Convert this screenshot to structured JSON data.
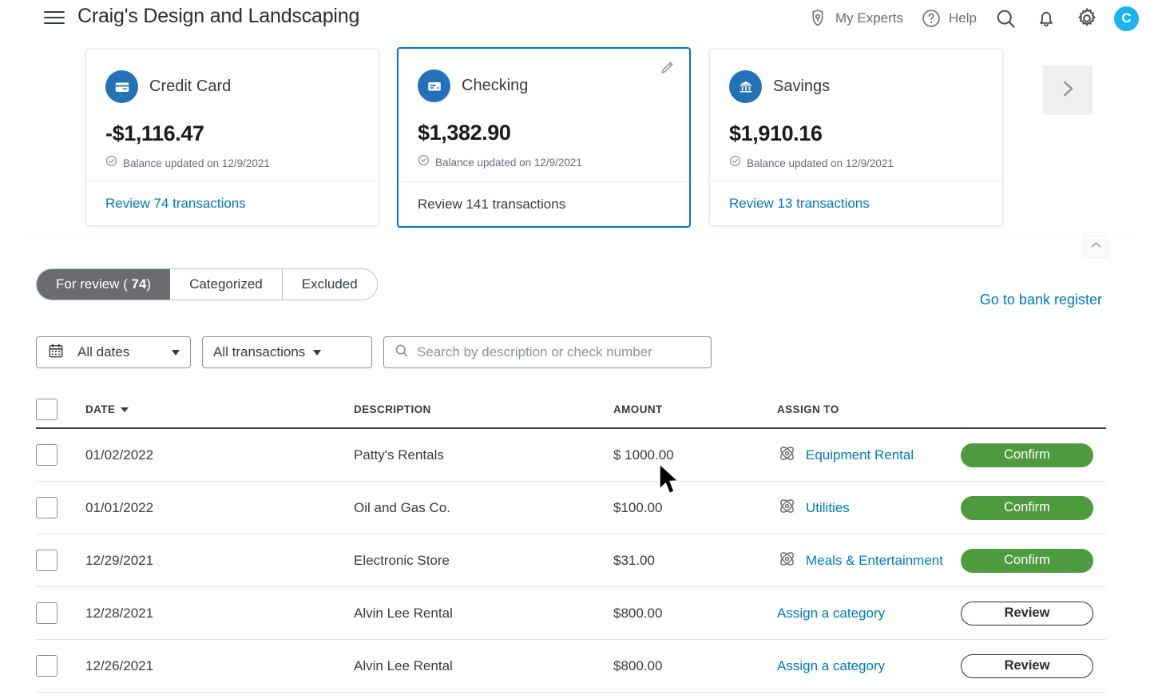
{
  "header": {
    "menu_icon": "hamburger-menu-icon",
    "company_title": "Craig's Design and Landscaping",
    "my_experts_label": "My Experts",
    "my_experts_icon": "person-shield-icon",
    "help_label": "Help",
    "help_icon": "question-circle-icon",
    "search_icon": "search-icon",
    "notifications_icon": "bell-icon",
    "settings_icon": "gear-icon",
    "avatar_initial": "C",
    "avatar_color": "#1ab2f0"
  },
  "accounts": [
    {
      "name": "Credit Card",
      "icon": "credit-card-icon",
      "balance": "-$1,116.47",
      "updated_text": "Balance updated on 12/9/2021",
      "updated_icon": "check-circle-icon",
      "review_link": "Review 74 transactions",
      "selected": false
    },
    {
      "name": "Checking",
      "icon": "checking-account-icon",
      "balance": "$1,382.90",
      "updated_text": "Balance updated on 12/9/2021",
      "updated_icon": "check-circle-icon",
      "review_link": "Review 141 transactions",
      "selected": true,
      "edit_icon": "pencil-edit-icon"
    },
    {
      "name": "Savings",
      "icon": "bank-building-icon",
      "balance": "$1,910.16",
      "updated_text": "Balance updated on 12/9/2021",
      "updated_icon": "check-circle-icon",
      "review_link": "Review 13 transactions",
      "selected": false
    }
  ],
  "carousel": {
    "next_icon": "chevron-right-icon"
  },
  "collapse": {
    "icon": "chevron-up-icon"
  },
  "tabs": [
    {
      "label": "For review",
      "count": "74",
      "active": true
    },
    {
      "label": "Categorized",
      "count": "",
      "active": false
    },
    {
      "label": "Excluded",
      "count": "",
      "active": false
    }
  ],
  "bank_register_link": "Go to bank register",
  "filters": {
    "date_filter_label": "All dates",
    "date_filter_icon": "calendar-icon",
    "type_filter_label": "All transactions",
    "search_placeholder": "Search by description or check number",
    "search_value": "",
    "search_icon": "search-icon"
  },
  "table": {
    "columns": {
      "date": "DATE",
      "description": "DESCRIPTION",
      "amount": "AMOUNT",
      "assign_to": "ASSIGN TO"
    },
    "sort_icon": "sort-descending-caret-icon",
    "rows": [
      {
        "date": "01/02/2022",
        "description": "Patty's Rentals",
        "amount": "$ 1000.00",
        "category": "Equipment Rental",
        "has_rule_icon": true,
        "rule_icon": "category-rule-icon",
        "action": "Confirm",
        "action_type": "confirm"
      },
      {
        "date": "01/01/2022",
        "description": "Oil and Gas Co.",
        "amount": "$100.00",
        "category": "Utilities",
        "has_rule_icon": true,
        "rule_icon": "category-rule-icon",
        "action": "Confirm",
        "action_type": "confirm"
      },
      {
        "date": "12/29/2021",
        "description": "Electronic Store",
        "amount": "$31.00",
        "category": "Meals & Entertainment",
        "has_rule_icon": true,
        "rule_icon": "category-rule-icon",
        "action": "Confirm",
        "action_type": "confirm"
      },
      {
        "date": "12/28/2021",
        "description": "Alvin Lee Rental",
        "amount": "$800.00",
        "category": "Assign a category",
        "has_rule_icon": false,
        "rule_icon": "",
        "action": "Review",
        "action_type": "review"
      },
      {
        "date": "12/26/2021",
        "description": "Alvin Lee Rental",
        "amount": "$800.00",
        "category": "Assign a category",
        "has_rule_icon": false,
        "rule_icon": "",
        "action": "Review",
        "action_type": "review"
      }
    ]
  },
  "colors": {
    "link_blue": "#0077c5",
    "confirm_green": "#4e9a3e",
    "selected_border": "#0077c5",
    "card_icon_blue": "#2471b8",
    "active_tab_gray": "#6b6c72"
  }
}
